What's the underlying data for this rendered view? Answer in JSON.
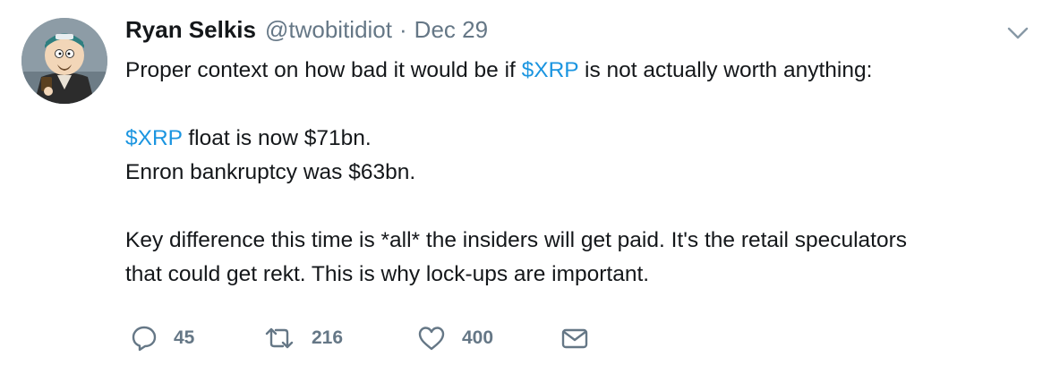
{
  "tweet": {
    "author": {
      "name": "Ryan Selkis",
      "handle": "@twobitidiot",
      "separator": "·",
      "date": "Dec 29"
    },
    "body": {
      "line1": {
        "before": "Proper context on how bad it would be if ",
        "cashtag": "$XRP",
        "after": " is not actually worth anything:"
      },
      "line2": {
        "cashtag": "$XRP",
        "after": " float is now $71bn."
      },
      "line3": "Enron bankruptcy was $63bn.",
      "line4": "Key difference this time is *all* the insiders will get paid. It's the retail speculators",
      "line5": "that could get rekt. This is why lock-ups are important."
    },
    "actions": {
      "reply_count": "45",
      "retweet_count": "216",
      "like_count": "400"
    },
    "icons": [
      "avatar",
      "chevron-down-icon",
      "reply-icon",
      "retweet-icon",
      "heart-icon",
      "message-icon"
    ],
    "colors": {
      "link": "#1b95e0",
      "muted": "#657786",
      "text": "#14171a"
    }
  }
}
